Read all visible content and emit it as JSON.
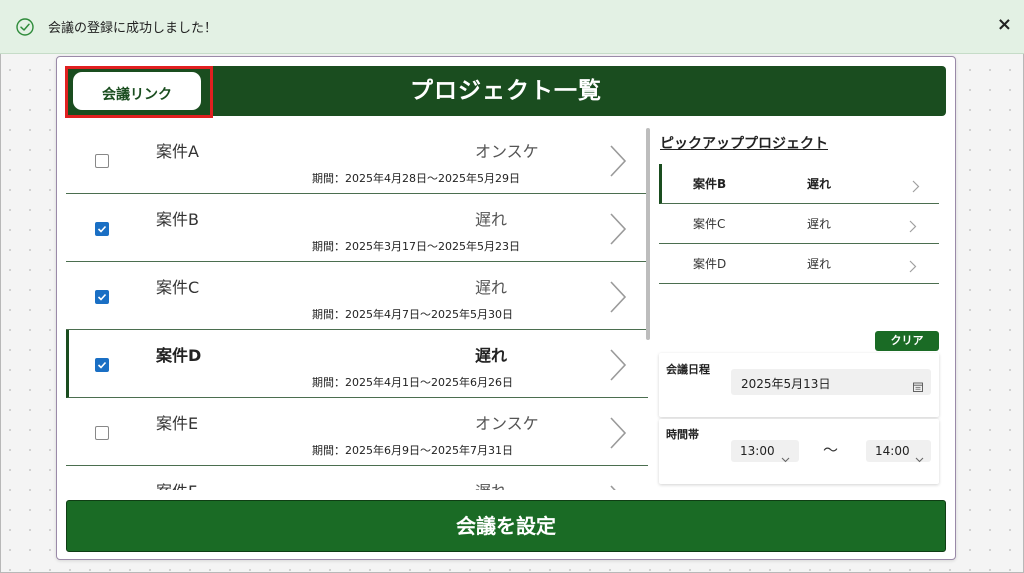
{
  "toast": {
    "message": "会議の登録に成功しました！",
    "close_glyph": "×",
    "color": "#e3f1e4",
    "icon_color": "#2e8b3a"
  },
  "header": {
    "title": "プロジェクト一覧",
    "link_label": "会議リンク",
    "color": "#1a4d1f",
    "highlight_color": "#e02020"
  },
  "projects": [
    {
      "name": "案件A",
      "status": "オンスケ",
      "period": "期間：2025年4月28日～2025年5月29日",
      "checked": false,
      "selected": false
    },
    {
      "name": "案件B",
      "status": "遅れ",
      "period": "期間：2025年3月17日～2025年5月23日",
      "checked": true,
      "selected": false
    },
    {
      "name": "案件C",
      "status": "遅れ",
      "period": "期間：2025年4月7日～2025年5月30日",
      "checked": true,
      "selected": false
    },
    {
      "name": "案件D",
      "status": "遅れ",
      "period": "期間：2025年4月1日～2025年6月26日",
      "checked": true,
      "selected": true
    },
    {
      "name": "案件E",
      "status": "オンスケ",
      "period": "期間：2025年6月9日～2025年7月31日",
      "checked": false,
      "selected": false
    },
    {
      "name": "案件F",
      "status": "遅れ",
      "period": "",
      "checked": false,
      "selected": false
    }
  ],
  "pickup": {
    "title": "ピックアッププロジェクト",
    "items": [
      {
        "name": "案件B",
        "status": "遅れ",
        "selected": true
      },
      {
        "name": "案件C",
        "status": "遅れ",
        "selected": false
      },
      {
        "name": "案件D",
        "status": "遅れ",
        "selected": false
      }
    ]
  },
  "meeting": {
    "clear_label": "クリア",
    "date_label": "会議日程",
    "date_value": "2025年5月13日",
    "time_label": "時間帯",
    "start_time": "13:00",
    "separator": "～",
    "end_time": "14:00"
  },
  "submit": {
    "label": "会議を設定",
    "color": "#1a6b25"
  },
  "accent_check_color": "#1a6fc4"
}
